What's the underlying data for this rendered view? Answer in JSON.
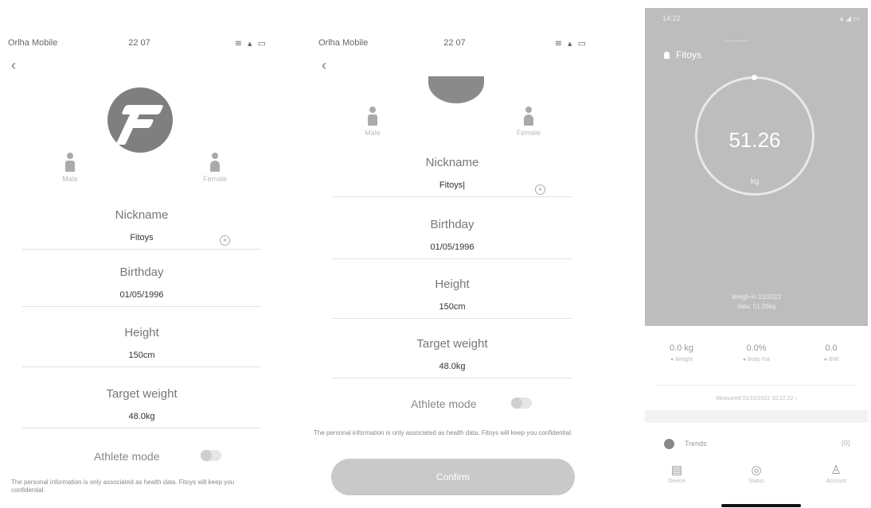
{
  "status": {
    "carrier": "Orlha Mobile",
    "time": "22 07",
    "icons": "≋ ▴ ▭"
  },
  "genders": {
    "male": "Male",
    "female": "Female"
  },
  "form": {
    "nickname_label": "Nickname",
    "nickname_value_1": "Fitoys",
    "nickname_value_2": "Fitoys|",
    "birthday_label": "Birthday",
    "birthday_value": "01/05/1996",
    "height_label": "Height",
    "height_value": "150cm",
    "target_label": "Target weight",
    "target_value": "48.0kg",
    "athlete_label": "Athlete mode",
    "note": "The personal information is only associated as health data. Fitoys will keep you confidential."
  },
  "confirm_label": "Confirm",
  "dashboard": {
    "status_time": "14:22",
    "status_icons": "▴ ◢ ▭",
    "user_name": "Fitoys",
    "user_sub": "— ———",
    "weight": "51.26",
    "unit": "kg",
    "hero_note": [
      "Weigh-in 21/2022",
      "data: 51.26kg"
    ],
    "stats": [
      {
        "value": "0.0 kg",
        "label": "● Weight"
      },
      {
        "value": "0.0%",
        "label": "● Body Fat"
      },
      {
        "value": "0.0",
        "label": "● BMI"
      }
    ],
    "history_link": "Measured 01/10/2022 10:22:22 ›",
    "trends_label": "Trends",
    "trends_count": "(0)",
    "nav": [
      {
        "icon": "▤",
        "label": "Device"
      },
      {
        "icon": "◎",
        "label": "Status"
      },
      {
        "icon": "♙",
        "label": "Account"
      }
    ]
  }
}
